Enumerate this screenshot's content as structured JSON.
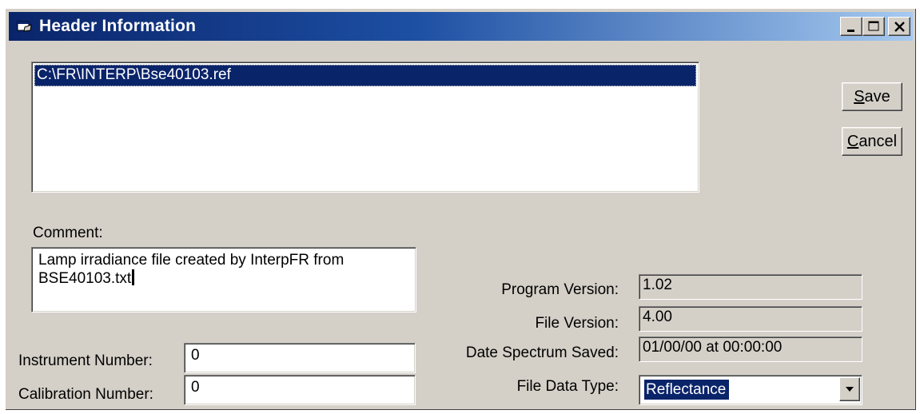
{
  "window": {
    "title": "Header Information",
    "minimize_icon": "minimize-icon",
    "maximize_icon": "maximize-icon",
    "close_icon": "close-icon",
    "app_icon": "app-window-icon"
  },
  "files": {
    "items": [
      "C:\\FR\\INTERP\\Bse40103.ref"
    ],
    "selected_index": 0
  },
  "buttons": {
    "save": {
      "access_key": "S",
      "rest": "ave"
    },
    "cancel": {
      "access_key": "C",
      "rest": "ancel"
    }
  },
  "comment": {
    "label": "Comment:",
    "line1": "Lamp irradiance file created by InterpFR from",
    "line2": "BSE40103.txt"
  },
  "instrument": {
    "label": "Instrument Number:",
    "value": "0"
  },
  "calibration": {
    "label": "Calibration Number:",
    "value": "0"
  },
  "program_version": {
    "label": "Program Version:",
    "value": "1.02"
  },
  "file_version": {
    "label": "File Version:",
    "value": "4.00"
  },
  "date_saved": {
    "label": "Date Spectrum Saved:",
    "value": "01/00/00 at 00:00:00"
  },
  "data_type": {
    "label": "File Data Type:",
    "value": "Reflectance",
    "arrow_icon": "dropdown-arrow-icon"
  },
  "colors": {
    "titlebar_start": "#0a246a",
    "titlebar_end": "#a6caf0",
    "face": "#d4d0c8",
    "selection": "#0a246a"
  }
}
